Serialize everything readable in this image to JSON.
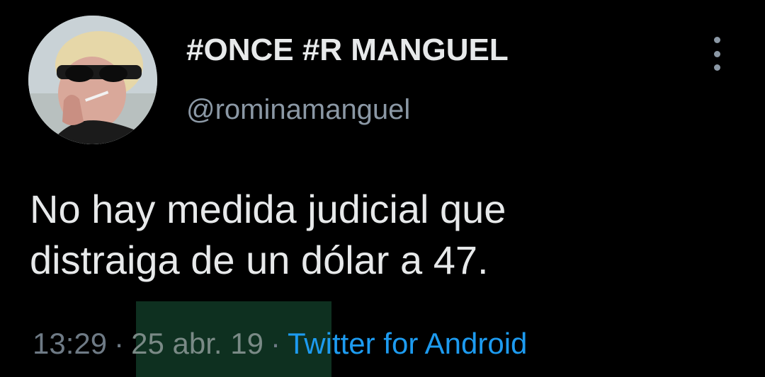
{
  "tweet": {
    "display_name": "#ONCE #R MANGUEL",
    "handle": "@rominamanguel",
    "text_lines": [
      "No hay medida judicial que",
      "distraiga de un dólar a 47."
    ],
    "time": "13:29",
    "separator": "·",
    "date": "25 abr. 19",
    "source": "Twitter for Android"
  },
  "menu": {
    "icon": "more-vertical-icon"
  },
  "colors": {
    "background": "#000000",
    "primary_text": "#e7e9ea",
    "secondary_text": "#8b98a5",
    "link": "#1d9bf0",
    "highlight": "#0e3020"
  }
}
